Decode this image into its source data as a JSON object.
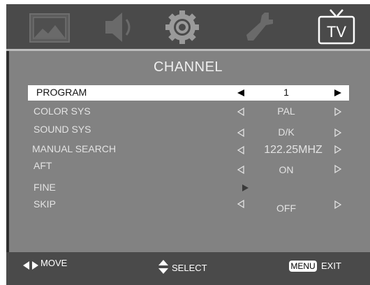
{
  "menu": {
    "title": "CHANNEL",
    "active_tab": "tv",
    "tabs": [
      {
        "id": "picture",
        "icon": "picture-icon"
      },
      {
        "id": "sound",
        "icon": "speaker-icon"
      },
      {
        "id": "setup",
        "icon": "gear-icon"
      },
      {
        "id": "function",
        "icon": "wrench-icon"
      },
      {
        "id": "tv",
        "icon": "tv-icon",
        "label": "TV"
      }
    ]
  },
  "rows": [
    {
      "label": "PROGRAM",
      "value": "1",
      "selected": true
    },
    {
      "label": "COLOR SYS",
      "value": "PAL"
    },
    {
      "label": "SOUND SYS",
      "value": "D/K"
    },
    {
      "label": "MANUAL SEARCH",
      "value": "122.25MHZ"
    },
    {
      "label": "AFT",
      "value": "ON"
    },
    {
      "label": "FINE",
      "value": ""
    },
    {
      "label": "SKIP",
      "value": "OFF"
    }
  ],
  "footer": {
    "move": "MOVE",
    "select": "SELECT",
    "menu_key": "MENU",
    "exit": "EXIT"
  },
  "colors": {
    "frame": "#4a4a4a",
    "panel": "#828282",
    "selected_row": "#ffffff",
    "text": "#e3e3e3"
  }
}
